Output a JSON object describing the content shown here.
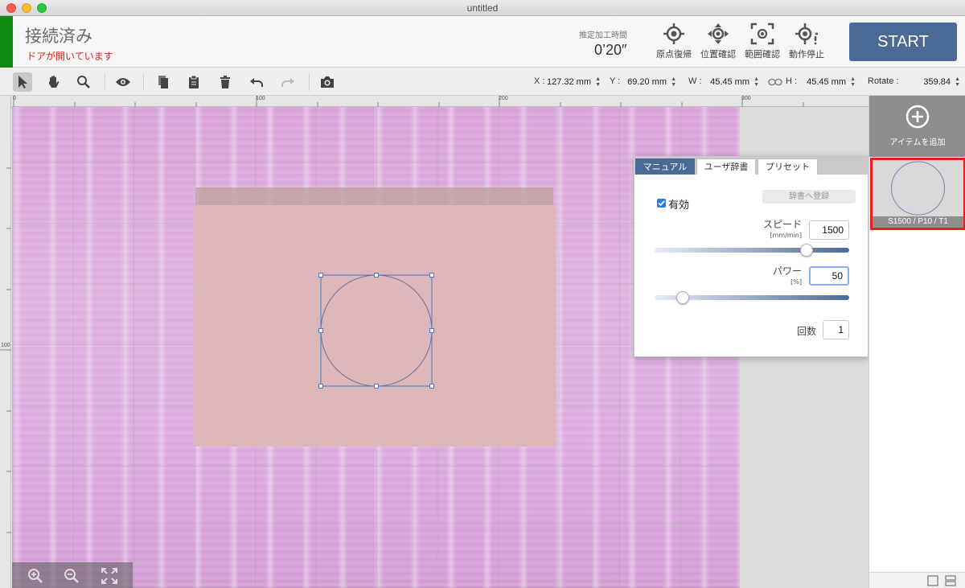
{
  "window": {
    "title": "untitled"
  },
  "header": {
    "status_title": "接続済み",
    "status_message": "ドアが開いています",
    "estimated_time_label": "推定加工時間",
    "estimated_time_value": "0’20″",
    "buttons": [
      {
        "label": "原点復帰",
        "icon": "home-target-icon"
      },
      {
        "label": "位置確認",
        "icon": "position-move-icon"
      },
      {
        "label": "範囲確認",
        "icon": "range-frame-icon"
      },
      {
        "label": "動作停止",
        "icon": "stop-target-icon"
      }
    ],
    "start_label": "START"
  },
  "toolbar": {
    "tools": [
      "select-arrow-icon",
      "hand-pan-icon",
      "magnifier-icon",
      "eye-icon",
      "copy-icon",
      "paste-icon",
      "trash-icon",
      "undo-icon",
      "redo-icon",
      "camera-icon"
    ],
    "x_label": "X :",
    "x_value": "127.32 mm",
    "y_label": "Y :",
    "y_value": "69.20 mm",
    "w_label": "W :",
    "w_value": "45.45 mm",
    "h_label": "H :",
    "h_value": "45.45 mm",
    "rotate_label": "Rotate :",
    "rotate_value": "359.84"
  },
  "rulers": {
    "top": [
      "0",
      "100",
      "200",
      "300"
    ],
    "left": [
      "100"
    ]
  },
  "panel": {
    "tabs": [
      "マニュアル",
      "ユーザ辞書",
      "プリセット"
    ],
    "active_tab": "マニュアル",
    "enabled_label": "有効",
    "enabled": true,
    "register_button": "辞書へ登録",
    "speed_label": "スピード",
    "speed_unit": "[mm/min]",
    "speed_value": "1500",
    "speed_slider": 0.8,
    "power_label": "パワー",
    "power_unit": "[%]",
    "power_value": "50",
    "power_slider": 0.12,
    "count_label": "回数",
    "count_value": "1"
  },
  "sidebar": {
    "add_label": "アイテムを追加",
    "item_label": "S1500 / P10 / T1"
  },
  "colors": {
    "accent": "#4b6a96",
    "status_ok": "#0f8a10",
    "warning": "#e02020",
    "selection": "#e81d1d"
  }
}
